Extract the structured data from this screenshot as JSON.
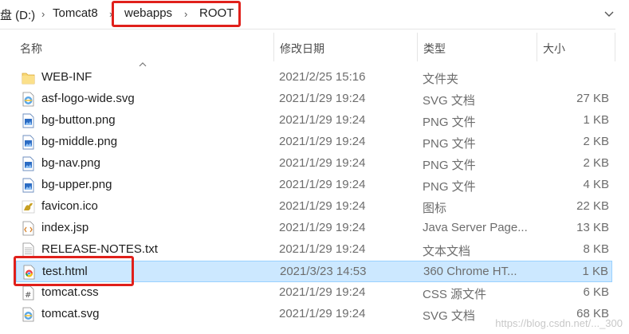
{
  "breadcrumb": {
    "items": [
      "盘 (D:)",
      "Tomcat8",
      "webapps",
      "ROOT"
    ]
  },
  "columns": {
    "name": "名称",
    "date": "修改日期",
    "type": "类型",
    "size": "大小"
  },
  "files": [
    {
      "name": "WEB-INF",
      "date": "2021/2/25 15:16",
      "type": "文件夹",
      "size": "",
      "icon": "folder-icon"
    },
    {
      "name": "asf-logo-wide.svg",
      "date": "2021/1/29 19:24",
      "type": "SVG 文档",
      "size": "27 KB",
      "icon": "svg-file-icon"
    },
    {
      "name": "bg-button.png",
      "date": "2021/1/29 19:24",
      "type": "PNG 文件",
      "size": "1 KB",
      "icon": "image-file-icon"
    },
    {
      "name": "bg-middle.png",
      "date": "2021/1/29 19:24",
      "type": "PNG 文件",
      "size": "2 KB",
      "icon": "image-file-icon"
    },
    {
      "name": "bg-nav.png",
      "date": "2021/1/29 19:24",
      "type": "PNG 文件",
      "size": "2 KB",
      "icon": "image-file-icon"
    },
    {
      "name": "bg-upper.png",
      "date": "2021/1/29 19:24",
      "type": "PNG 文件",
      "size": "4 KB",
      "icon": "image-file-icon"
    },
    {
      "name": "favicon.ico",
      "date": "2021/1/29 19:24",
      "type": "图标",
      "size": "22 KB",
      "icon": "tomcat-ico-icon"
    },
    {
      "name": "index.jsp",
      "date": "2021/1/29 19:24",
      "type": "Java Server Page...",
      "size": "13 KB",
      "icon": "jsp-file-icon"
    },
    {
      "name": "RELEASE-NOTES.txt",
      "date": "2021/1/29 19:24",
      "type": "文本文档",
      "size": "8 KB",
      "icon": "text-file-icon"
    },
    {
      "name": "test.html",
      "date": "2021/3/23 14:53",
      "type": "360 Chrome HT...",
      "size": "1 KB",
      "icon": "chrome-html-icon",
      "selected": true
    },
    {
      "name": "tomcat.css",
      "date": "2021/1/29 19:24",
      "type": "CSS 源文件",
      "size": "6 KB",
      "icon": "css-file-icon"
    },
    {
      "name": "tomcat.svg",
      "date": "2021/1/29 19:24",
      "type": "SVG 文档",
      "size": "68 KB",
      "icon": "svg-file-icon"
    }
  ],
  "watermark": "https://blog.csdn.net/..._300",
  "colors": {
    "highlight": "#e0201b",
    "selection": "#cce8ff",
    "selection_border": "#99d1ff"
  }
}
